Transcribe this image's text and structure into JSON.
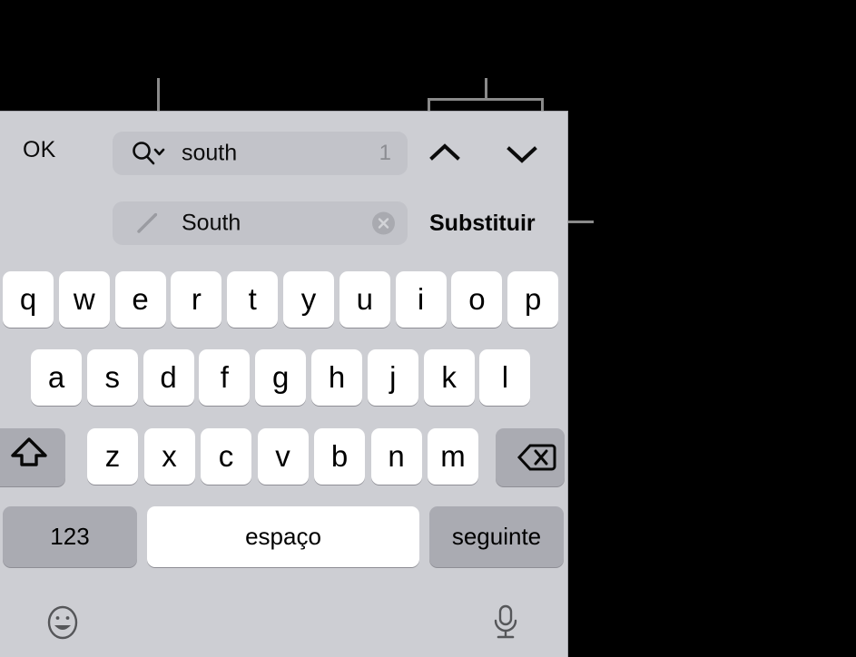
{
  "panel": {
    "background_color": "#cdced3",
    "key_color": "#ffffff",
    "special_key_color": "#aaabb2"
  },
  "find_bar": {
    "done_label": "OK",
    "search": {
      "value": "south",
      "match_count": "1",
      "icon": "magnifier-chevron-icon"
    },
    "replace": {
      "value": "South",
      "icon": "pencil-icon",
      "clear_icon": "clear-circle-x-icon"
    },
    "prev_icon": "chevron-up-icon",
    "next_icon": "chevron-down-icon",
    "replace_label": "Substituir"
  },
  "keyboard": {
    "row1": [
      "q",
      "w",
      "e",
      "r",
      "t",
      "y",
      "u",
      "i",
      "o",
      "p"
    ],
    "row2": [
      "a",
      "s",
      "d",
      "f",
      "g",
      "h",
      "j",
      "k",
      "l"
    ],
    "row3": [
      "z",
      "x",
      "c",
      "v",
      "b",
      "n",
      "m"
    ],
    "shift_icon": "shift-arrow-icon",
    "backspace_icon": "backspace-delete-icon",
    "numbers_label": "123",
    "space_label": "espaço",
    "return_label": "seguinte",
    "emoji_icon": "smiley-face-icon",
    "dictation_icon": "microphone-icon"
  },
  "callouts": {
    "line_color": "#8a8a8a",
    "leaders": [
      "search-field-leader",
      "navigation-buttons-bracket",
      "replace-button-leader"
    ]
  }
}
